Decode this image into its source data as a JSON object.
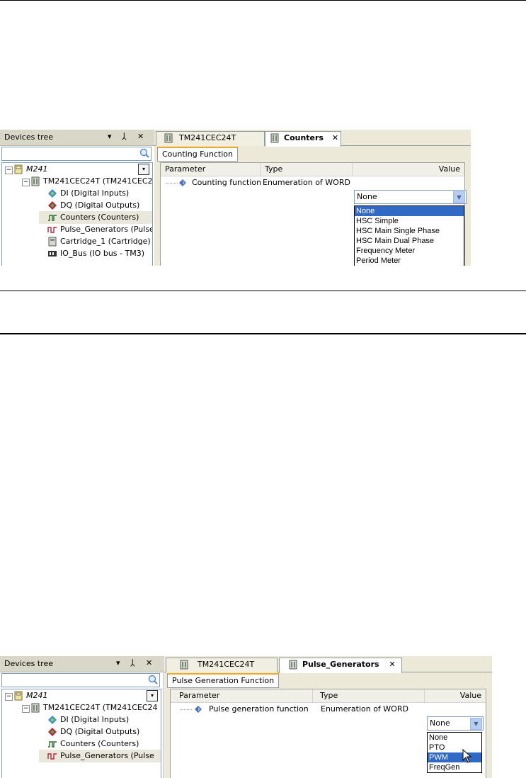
{
  "screenshot1": {
    "devices_tree": {
      "title": "Devices tree",
      "pin_label": "▾ ⊥",
      "close_label": "✕",
      "items": [
        {
          "label": "M241"
        },
        {
          "label": "TM241CEC24T (TM241CEC24"
        },
        {
          "label": "DI (Digital Inputs)"
        },
        {
          "label": "DQ (Digital Outputs)"
        },
        {
          "label": "Counters (Counters)"
        },
        {
          "label": "Pulse_Generators (Pulse"
        },
        {
          "label": "Cartridge_1 (Cartridge)"
        },
        {
          "label": "IO_Bus (IO bus - TM3)"
        }
      ]
    },
    "tabs": [
      {
        "label": "TM241CEC24T"
      },
      {
        "label": "Counters"
      }
    ],
    "tab_close": "✕",
    "subtab": "Counting Function",
    "grid": {
      "col_parameter": "Parameter",
      "col_type": "Type",
      "col_value": "Value",
      "row": {
        "parameter": "Counting function",
        "type": "Enumeration of WORD",
        "value": "None"
      }
    },
    "dropdown": {
      "options": [
        "None",
        "HSC Simple",
        "HSC Main Single Phase",
        "HSC Main Dual Phase",
        "Frequency Meter",
        "Period Meter"
      ],
      "highlighted": "None"
    }
  },
  "screenshot2": {
    "devices_tree": {
      "title": "Devices tree",
      "pin_label": "▾ ⊥",
      "close_label": "✕",
      "items": [
        {
          "label": "M241"
        },
        {
          "label": "TM241CEC24T (TM241CEC24"
        },
        {
          "label": "DI (Digital Inputs)"
        },
        {
          "label": "DQ (Digital Outputs)"
        },
        {
          "label": "Counters (Counters)"
        },
        {
          "label": "Pulse_Generators (Pulse"
        }
      ]
    },
    "tabs": [
      {
        "label": "TM241CEC24T"
      },
      {
        "label": "Pulse_Generators"
      }
    ],
    "tab_close": "✕",
    "subtab": "Pulse Generation Function",
    "grid": {
      "col_parameter": "Parameter",
      "col_type": "Type",
      "col_value": "Value",
      "row": {
        "parameter": "Pulse generation function",
        "type": "Enumeration of WORD",
        "value": "None"
      }
    },
    "dropdown": {
      "options": [
        "None",
        "PTO",
        "PWM",
        "FreqGen"
      ],
      "highlighted": "PWM"
    }
  },
  "colors": {
    "accent_tab": "#f5a623",
    "selection": "#316ac5",
    "header_bg": "#d8d7c8"
  }
}
